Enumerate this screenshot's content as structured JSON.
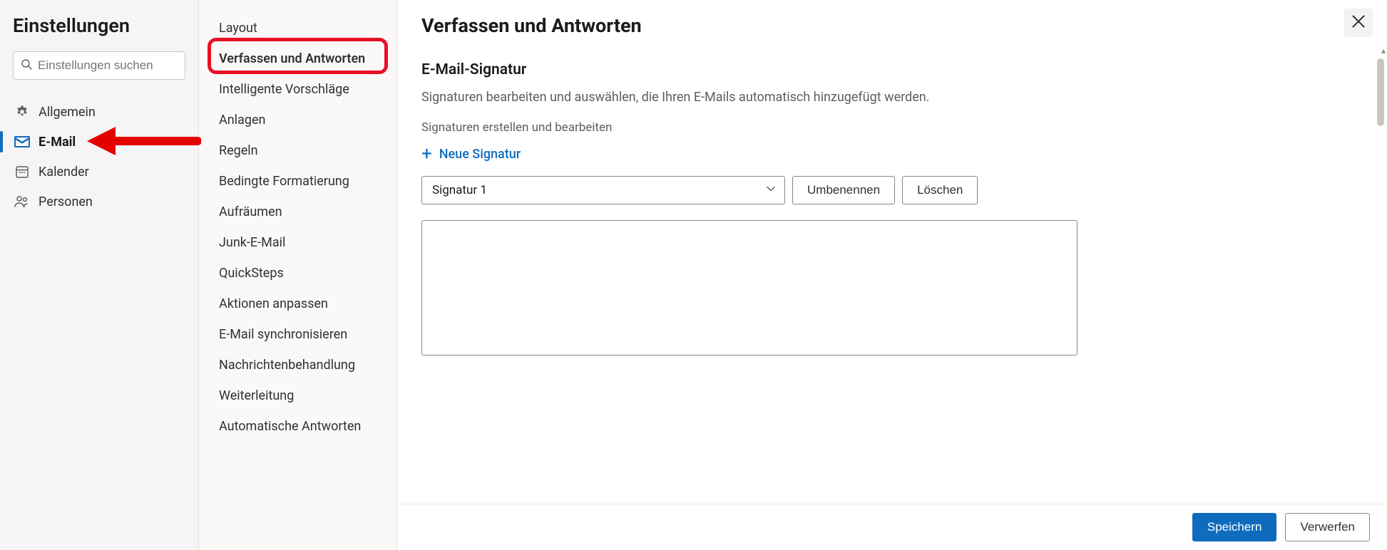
{
  "sidebar": {
    "title": "Einstellungen",
    "search_placeholder": "Einstellungen suchen",
    "items": [
      {
        "id": "general",
        "label": "Allgemein",
        "icon": "gear"
      },
      {
        "id": "email",
        "label": "E-Mail",
        "icon": "mail",
        "active": true
      },
      {
        "id": "calendar",
        "label": "Kalender",
        "icon": "calendar"
      },
      {
        "id": "people",
        "label": "Personen",
        "icon": "people"
      }
    ]
  },
  "subnav": {
    "items": [
      "Layout",
      "Verfassen und Antworten",
      "Intelligente Vorschläge",
      "Anlagen",
      "Regeln",
      "Bedingte Formatierung",
      "Aufräumen",
      "Junk-E-Mail",
      "QuickSteps",
      "Aktionen anpassen",
      "E-Mail synchronisieren",
      "Nachrichtenbehandlung",
      "Weiterleitung",
      "Automatische Antworten"
    ],
    "highlighted_index": 1
  },
  "main": {
    "title": "Verfassen und Antworten",
    "signature": {
      "heading": "E-Mail-Signatur",
      "description": "Signaturen bearbeiten und auswählen, die Ihren E-Mails automatisch hinzugefügt werden.",
      "create_label": "Signaturen erstellen und bearbeiten",
      "new_button": "Neue Signatur",
      "selected": "Signatur 1",
      "rename_button": "Umbenennen",
      "delete_button": "Löschen"
    },
    "footer": {
      "save": "Speichern",
      "discard": "Verwerfen"
    }
  },
  "annotations": {
    "highlight_color": "#e81123",
    "arrow_color": "#e50000"
  }
}
